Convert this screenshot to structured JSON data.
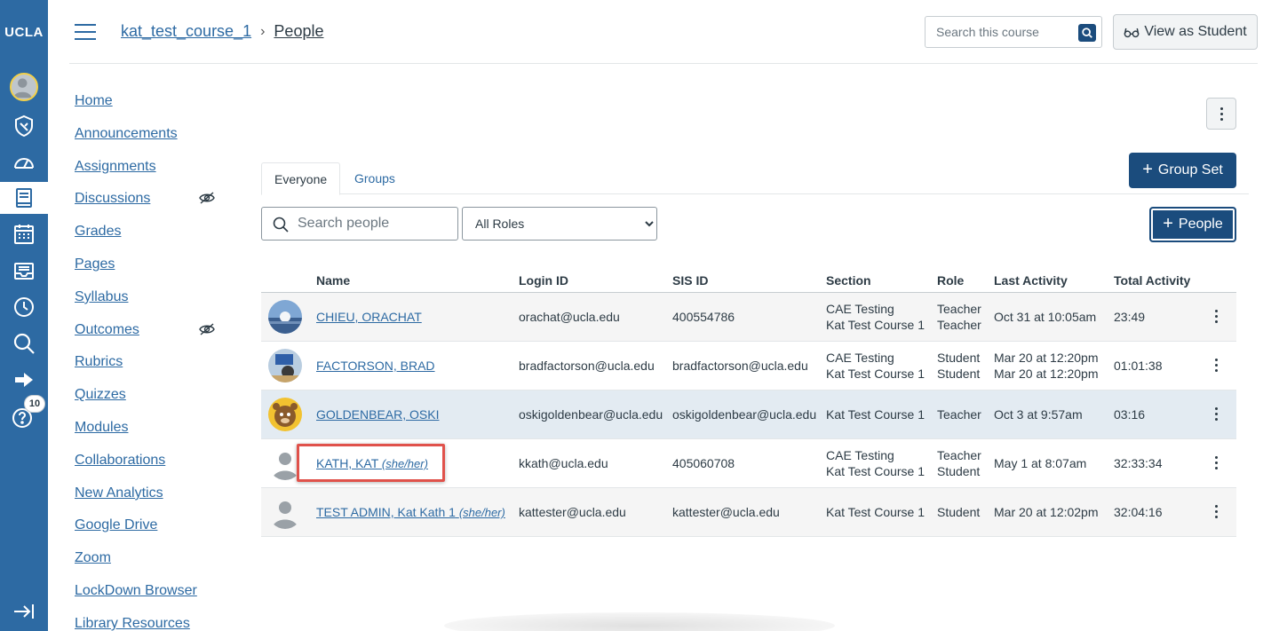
{
  "global_nav": {
    "logo": "UCLA",
    "icons": [
      "account-avatar-icon",
      "admin-shield-icon",
      "dashboard-icon",
      "courses-icon",
      "calendar-icon",
      "inbox-icon",
      "history-icon",
      "search-icon",
      "logout-icon",
      "help-icon",
      "collapse-nav-icon"
    ],
    "help_badge": "10",
    "brand_color": "#2d6aa3"
  },
  "header": {
    "course_link": "kat_test_course_1",
    "separator": "›",
    "current_page": "People",
    "search_placeholder": "Search this course",
    "view_as_student": "View as Student"
  },
  "course_nav": {
    "items": [
      "Home",
      "Announcements",
      "Assignments",
      "Discussions",
      "Grades",
      "Pages",
      "Syllabus",
      "Outcomes",
      "Rubrics",
      "Quizzes",
      "Modules",
      "Collaborations",
      "New Analytics",
      "Google Drive",
      "Zoom",
      "LockDown Browser",
      "Library Resources"
    ]
  },
  "tabs": {
    "everyone": "Everyone",
    "groups": "Groups"
  },
  "buttons": {
    "group_set": "Group Set",
    "people": "People",
    "plus": "+"
  },
  "filters": {
    "search_placeholder": "Search people",
    "role_selected": "All Roles"
  },
  "table": {
    "headers": {
      "name": "Name",
      "login_id": "Login ID",
      "sis_id": "SIS ID",
      "section": "Section",
      "role": "Role",
      "last_activity": "Last Activity",
      "total_activity": "Total Activity"
    },
    "rows": [
      {
        "name": "CHIEU, ORACHAT",
        "pronouns": "",
        "login_id": "orachat@ucla.edu",
        "sis_id": "400554786",
        "section_1": "CAE Testing",
        "section_2": "Kat Test Course 1",
        "role_1": "Teacher",
        "role_2": "Teacher",
        "last_1": "Oct 31 at 10:05am",
        "last_2": "",
        "total": "23:49"
      },
      {
        "name": "FACTORSON, BRAD",
        "pronouns": "",
        "login_id": "bradfactorson@ucla.edu",
        "sis_id": "bradfactorson@ucla.edu",
        "section_1": "CAE Testing",
        "section_2": "Kat Test Course 1",
        "role_1": "Student",
        "role_2": "Student",
        "last_1": "Mar 20 at 12:20pm",
        "last_2": "Mar 20 at 12:20pm",
        "total": "01:01:38"
      },
      {
        "name": "GOLDENBEAR, OSKI",
        "pronouns": "",
        "login_id": "oskigoldenbear@ucla.edu",
        "sis_id": "oskigoldenbear@ucla.edu",
        "section_1": "Kat Test Course 1",
        "section_2": "",
        "role_1": "Teacher",
        "role_2": "",
        "last_1": "Oct 3 at 9:57am",
        "last_2": "",
        "total": "03:16"
      },
      {
        "name": "KATH, KAT",
        "pronouns": "(she/her)",
        "login_id": "kkath@ucla.edu",
        "sis_id": "405060708",
        "section_1": "CAE Testing",
        "section_2": "Kat Test Course 1",
        "role_1": "Teacher",
        "role_2": "Student",
        "last_1": "May 1 at 8:07am",
        "last_2": "",
        "total": "32:33:34"
      },
      {
        "name": "TEST ADMIN, Kat Kath 1",
        "pronouns": "(she/her)",
        "login_id": "kattester@ucla.edu",
        "sis_id": "kattester@ucla.edu",
        "section_1": "Kat Test Course 1",
        "section_2": "",
        "role_1": "Student",
        "role_2": "",
        "last_1": "Mar 20 at 12:02pm",
        "last_2": "",
        "total": "32:04:16"
      }
    ]
  },
  "colors": {
    "link": "#2d6aa3",
    "primary_button": "#1b4c7d",
    "highlight_row": "#e3ebf2",
    "annotation_box": "#e0524b"
  }
}
